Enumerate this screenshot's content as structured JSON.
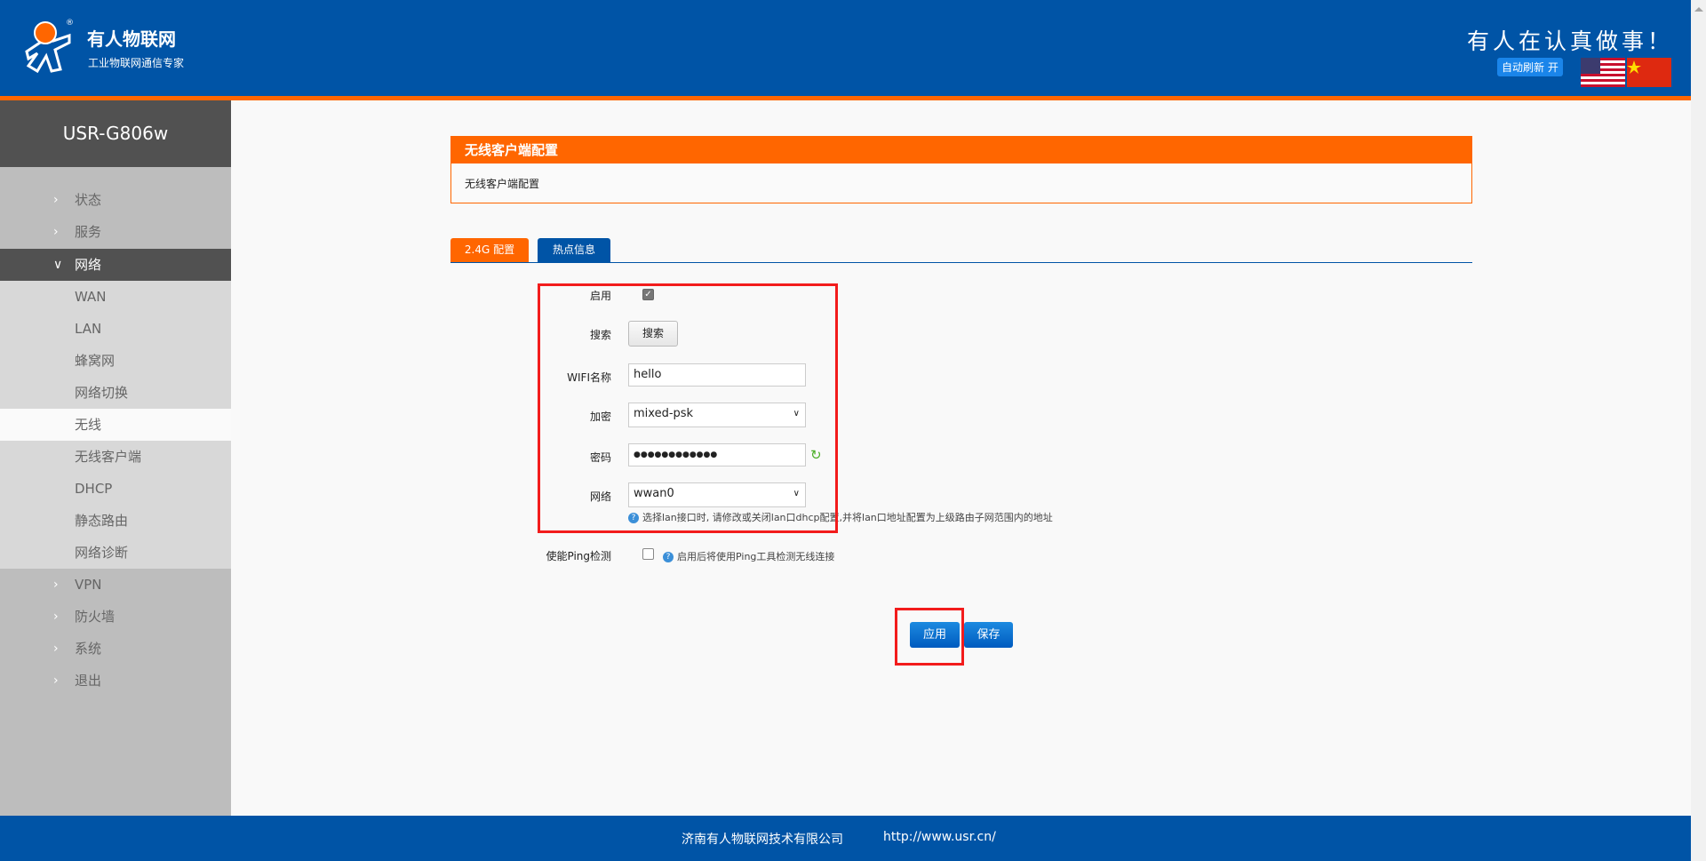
{
  "header": {
    "brand": "有人物联网",
    "brand_sub": "工业物联网通信专家",
    "slogan": "有人在认真做事！",
    "auto_refresh": "自动刷新 开",
    "colors": {
      "blue": "#0054a6",
      "orange": "#ff6600"
    }
  },
  "sidebar": {
    "device": "USR-G806w",
    "items": [
      {
        "label": "状态"
      },
      {
        "label": "服务"
      },
      {
        "label": "网络"
      },
      {
        "label": "WAN"
      },
      {
        "label": "LAN"
      },
      {
        "label": "蜂窝网"
      },
      {
        "label": "网络切换"
      },
      {
        "label": "无线"
      },
      {
        "label": "无线客户端"
      },
      {
        "label": "DHCP"
      },
      {
        "label": "静态路由"
      },
      {
        "label": "网络诊断"
      },
      {
        "label": "VPN"
      },
      {
        "label": "防火墙"
      },
      {
        "label": "系统"
      },
      {
        "label": "退出"
      }
    ]
  },
  "panel": {
    "title": "无线客户端配置",
    "description": "无线客户端配置"
  },
  "tabs": [
    {
      "label": "2.4G 配置"
    },
    {
      "label": "热点信息"
    }
  ],
  "form": {
    "enable_label": "启用",
    "enable_checked": true,
    "search_label": "搜索",
    "search_button": "搜索",
    "ssid_label": "WIFI名称",
    "ssid_value": "hello",
    "encryption_label": "加密",
    "encryption_value": "mixed-psk",
    "password_label": "密码",
    "password_value": "●●●●●●●●●●●●",
    "network_label": "网络",
    "network_value": "wwan0",
    "network_hint": "选择lan接口时, 请修改或关闭lan口dhcp配置,并将lan口地址配置为上级路由子网范围内的地址",
    "ping_label": "使能Ping检测",
    "ping_checked": false,
    "ping_hint": "启用后将使用Ping工具检测无线连接"
  },
  "actions": {
    "apply": "应用",
    "save": "保存"
  },
  "footer": {
    "company": "济南有人物联网技术有限公司",
    "url": "http://www.usr.cn/"
  }
}
